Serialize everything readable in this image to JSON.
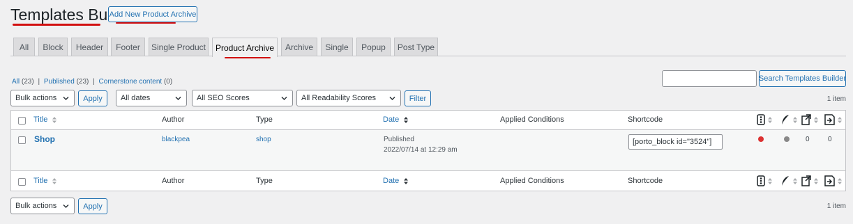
{
  "header": {
    "title": "Templates Builder",
    "add_button": "Add New Product Archive"
  },
  "tabs": [
    {
      "label": "All"
    },
    {
      "label": "Block"
    },
    {
      "label": "Header"
    },
    {
      "label": "Footer"
    },
    {
      "label": "Single Product"
    },
    {
      "label": "Product Archive",
      "active": true
    },
    {
      "label": "Archive"
    },
    {
      "label": "Single"
    },
    {
      "label": "Popup"
    },
    {
      "label": "Post Type"
    }
  ],
  "views": {
    "all": "All",
    "all_count": "(23)",
    "published": "Published",
    "published_count": "(23)",
    "cornerstone": "Cornerstone content",
    "cornerstone_count": "(0)",
    "sep": "|"
  },
  "search": {
    "value": "",
    "button": "Search Templates Builder"
  },
  "filters": {
    "bulk_actions": "Bulk actions",
    "apply": "Apply",
    "dates": "All dates",
    "seo": "All SEO Scores",
    "readability": "All Readability Scores",
    "filter": "Filter"
  },
  "items_count": "1 item",
  "columns": {
    "title": "Title",
    "author": "Author",
    "type": "Type",
    "date": "Date",
    "applied_conditions": "Applied Conditions",
    "shortcode": "Shortcode"
  },
  "rows": [
    {
      "title": "Shop",
      "author": "blackpea",
      "type": "shop",
      "status": "Published",
      "date": "2022/07/14 at 12:29 am",
      "shortcode": "[porto_block id=\"3524\"]",
      "seo_color": "#dc3232",
      "readability_color": "#888888",
      "links_out": "0",
      "links_in": "0"
    }
  ],
  "bottom": {
    "bulk_actions": "Bulk actions",
    "apply": "Apply",
    "items_count": "1 item"
  },
  "colors": {
    "accent": "#2271b1",
    "annotation": "#d20f0f"
  }
}
